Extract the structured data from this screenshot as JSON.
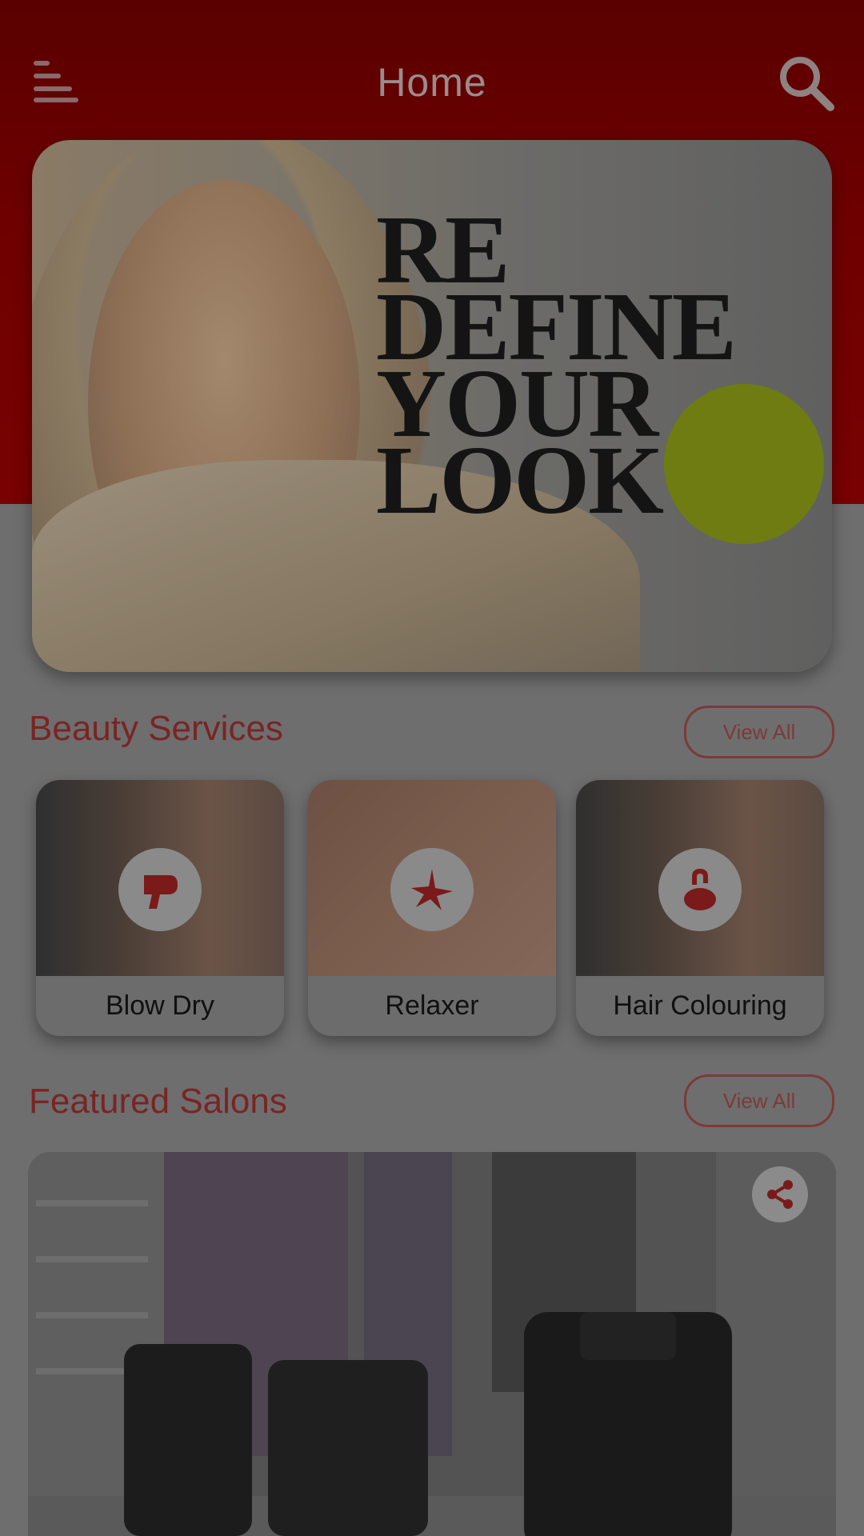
{
  "header": {
    "title": "Home",
    "menu_icon": "hamburger-menu-icon",
    "search_icon": "search-icon"
  },
  "hero_banner": {
    "headline": "RE\nDEFINE\nYOUR\nLOOK",
    "badge_text": "",
    "badge_color": "#6f7c12"
  },
  "beauty_services": {
    "title": "Beauty Services",
    "view_all_label": "View All",
    "items": [
      {
        "label": "Blow Dry",
        "icon": "hair-dryer-icon"
      },
      {
        "label": "Relaxer",
        "icon": "relaxer-icon"
      },
      {
        "label": "Hair Colouring",
        "icon": "hair-colour-icon"
      }
    ]
  },
  "featured_salons": {
    "title": "Featured Salons",
    "view_all_label": "View All",
    "share_icon": "share-icon"
  },
  "colors": {
    "header_bg": "#6f0000",
    "accent": "#7a2424",
    "icon_red": "#7a1a1a"
  }
}
